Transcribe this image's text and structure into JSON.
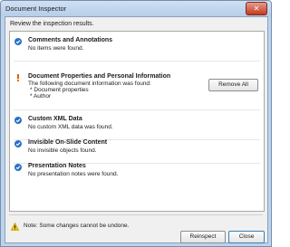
{
  "window": {
    "title": "Document Inspector",
    "close_glyph": "✕"
  },
  "instruction": "Review the inspection results.",
  "sections": [
    {
      "title": "Comments and Annotations",
      "status": "ok",
      "icon": "check-icon",
      "lines": [
        "No items were found."
      ]
    },
    {
      "title": "Document Properties and Personal Information",
      "status": "warning",
      "icon": "exclamation-icon",
      "lines": [
        "The following document information was found:",
        "* Document properties",
        "* Author"
      ],
      "action": "Remove All"
    },
    {
      "title": "Custom XML Data",
      "status": "ok",
      "icon": "check-icon",
      "lines": [
        "No custom XML data was found."
      ]
    },
    {
      "title": "Invisible On-Slide Content",
      "status": "ok",
      "icon": "check-icon",
      "lines": [
        "No invisible objects found."
      ]
    },
    {
      "title": "Presentation Notes",
      "status": "ok",
      "icon": "check-icon",
      "lines": [
        "No presentation notes were found."
      ]
    }
  ],
  "footer": {
    "note": "Note: Some changes cannot be undone.",
    "reinspect_label": "Reinspect",
    "close_label": "Close"
  },
  "colors": {
    "check": "#2b6fc7",
    "warning": "#e25a00",
    "title_bar": "#c4d8f0",
    "close_button": "#c8452d"
  }
}
